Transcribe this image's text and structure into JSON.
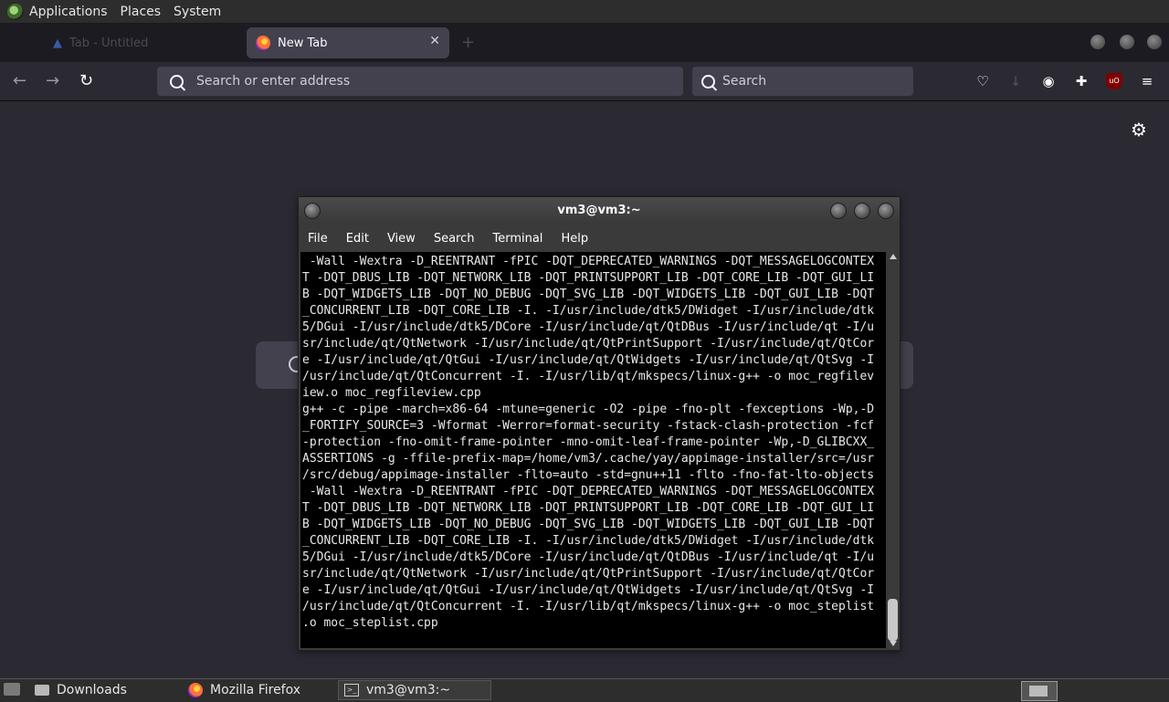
{
  "top_panel": {
    "menus": [
      "Applications",
      "Places",
      "System"
    ]
  },
  "browser": {
    "tabs": [
      {
        "label": "Tab - Untitled",
        "active": false
      },
      {
        "label": "New Tab",
        "active": true
      }
    ],
    "close_tab": "✕",
    "new_tab": "+",
    "urlbar_placeholder": "Search or enter address",
    "searchbar_placeholder": "Search",
    "nav": {
      "back": "←",
      "forward": "→",
      "reload": "↻"
    },
    "toolbar_icons": [
      "pocket-icon",
      "download-icon",
      "account-icon",
      "extensions-icon",
      "ublock-icon",
      "menu-icon"
    ],
    "ublock_label": "uO"
  },
  "terminal": {
    "title": "vm3@vm3:~",
    "menu": [
      "File",
      "Edit",
      "View",
      "Search",
      "Terminal",
      "Help"
    ],
    "lines": [
      " -Wall -Wextra -D_REENTRANT -fPIC -DQT_DEPRECATED_WARNINGS -DQT_MESSAGELOGCONTEX",
      "T -DQT_DBUS_LIB -DQT_NETWORK_LIB -DQT_PRINTSUPPORT_LIB -DQT_CORE_LIB -DQT_GUI_LI",
      "B -DQT_WIDGETS_LIB -DQT_NO_DEBUG -DQT_SVG_LIB -DQT_WIDGETS_LIB -DQT_GUI_LIB -DQT",
      "_CONCURRENT_LIB -DQT_CORE_LIB -I. -I/usr/include/dtk5/DWidget -I/usr/include/dtk",
      "5/DGui -I/usr/include/dtk5/DCore -I/usr/include/qt/QtDBus -I/usr/include/qt -I/u",
      "sr/include/qt/QtNetwork -I/usr/include/qt/QtPrintSupport -I/usr/include/qt/QtCor",
      "e -I/usr/include/qt/QtGui -I/usr/include/qt/QtWidgets -I/usr/include/qt/QtSvg -I",
      "/usr/include/qt/QtConcurrent -I. -I/usr/lib/qt/mkspecs/linux-g++ -o moc_regfilev",
      "iew.o moc_regfileview.cpp",
      "g++ -c -pipe -march=x86-64 -mtune=generic -O2 -pipe -fno-plt -fexceptions -Wp,-D",
      "_FORTIFY_SOURCE=3 -Wformat -Werror=format-security -fstack-clash-protection -fcf",
      "-protection -fno-omit-frame-pointer -mno-omit-leaf-frame-pointer -Wp,-D_GLIBCXX_",
      "ASSERTIONS -g -ffile-prefix-map=/home/vm3/.cache/yay/appimage-installer/src=/usr",
      "/src/debug/appimage-installer -flto=auto -std=gnu++11 -flto -fno-fat-lto-objects",
      " -Wall -Wextra -D_REENTRANT -fPIC -DQT_DEPRECATED_WARNINGS -DQT_MESSAGELOGCONTEX",
      "T -DQT_DBUS_LIB -DQT_NETWORK_LIB -DQT_PRINTSUPPORT_LIB -DQT_CORE_LIB -DQT_GUI_LI",
      "B -DQT_WIDGETS_LIB -DQT_NO_DEBUG -DQT_SVG_LIB -DQT_WIDGETS_LIB -DQT_GUI_LIB -DQT",
      "_CONCURRENT_LIB -DQT_CORE_LIB -I. -I/usr/include/dtk5/DWidget -I/usr/include/dtk",
      "5/DGui -I/usr/include/dtk5/DCore -I/usr/include/qt/QtDBus -I/usr/include/qt -I/u",
      "sr/include/qt/QtNetwork -I/usr/include/qt/QtPrintSupport -I/usr/include/qt/QtCor",
      "e -I/usr/include/qt/QtGui -I/usr/include/qt/QtWidgets -I/usr/include/qt/QtSvg -I",
      "/usr/include/qt/QtConcurrent -I. -I/usr/lib/qt/mkspecs/linux-g++ -o moc_steplist",
      ".o moc_steplist.cpp"
    ]
  },
  "taskbar": {
    "items": [
      {
        "label": "Downloads",
        "icon": "folder-icon"
      },
      {
        "label": "Mozilla Firefox",
        "icon": "firefox-icon"
      },
      {
        "label": "vm3@vm3:~",
        "icon": "terminal-icon",
        "active": true
      }
    ]
  },
  "colors": {
    "browser_bg": "#2b2a33",
    "tabstrip_bg": "#1c1b22",
    "field_bg": "#42414d",
    "terminal_bg": "#000000",
    "panel_bg": "#2d2d2d"
  }
}
